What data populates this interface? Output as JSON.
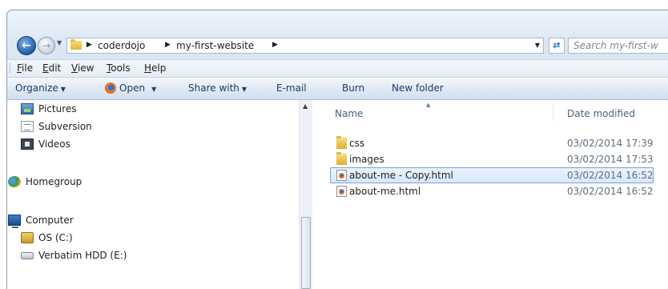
{
  "address": {
    "crumbs": [
      "coderdojo",
      "my-first-website"
    ],
    "search_placeholder": "Search my-first-w"
  },
  "menu": [
    "File",
    "Edit",
    "View",
    "Tools",
    "Help"
  ],
  "menu_accel": [
    "F",
    "E",
    "V",
    "T",
    "H"
  ],
  "commands": {
    "organize": "Organize",
    "open": "Open",
    "share": "Share with",
    "email": "E-mail",
    "burn": "Burn",
    "new_folder": "New folder"
  },
  "nav": {
    "pictures": "Pictures",
    "subversion": "Subversion",
    "videos": "Videos",
    "homegroup": "Homegroup",
    "computer": "Computer",
    "os_drive": "OS (C:)",
    "hdd": "Verbatim HDD (E:)"
  },
  "columns": {
    "name": "Name",
    "date": "Date modified"
  },
  "files": [
    {
      "name": "css",
      "date": "03/02/2014 17:39",
      "kind": "folder"
    },
    {
      "name": "images",
      "date": "03/02/2014 17:53",
      "kind": "folder"
    },
    {
      "name": "about-me - Copy.html",
      "date": "03/02/2014 16:52",
      "kind": "html",
      "selected": true
    },
    {
      "name": "about-me.html",
      "date": "03/02/2014 16:52",
      "kind": "html"
    }
  ]
}
